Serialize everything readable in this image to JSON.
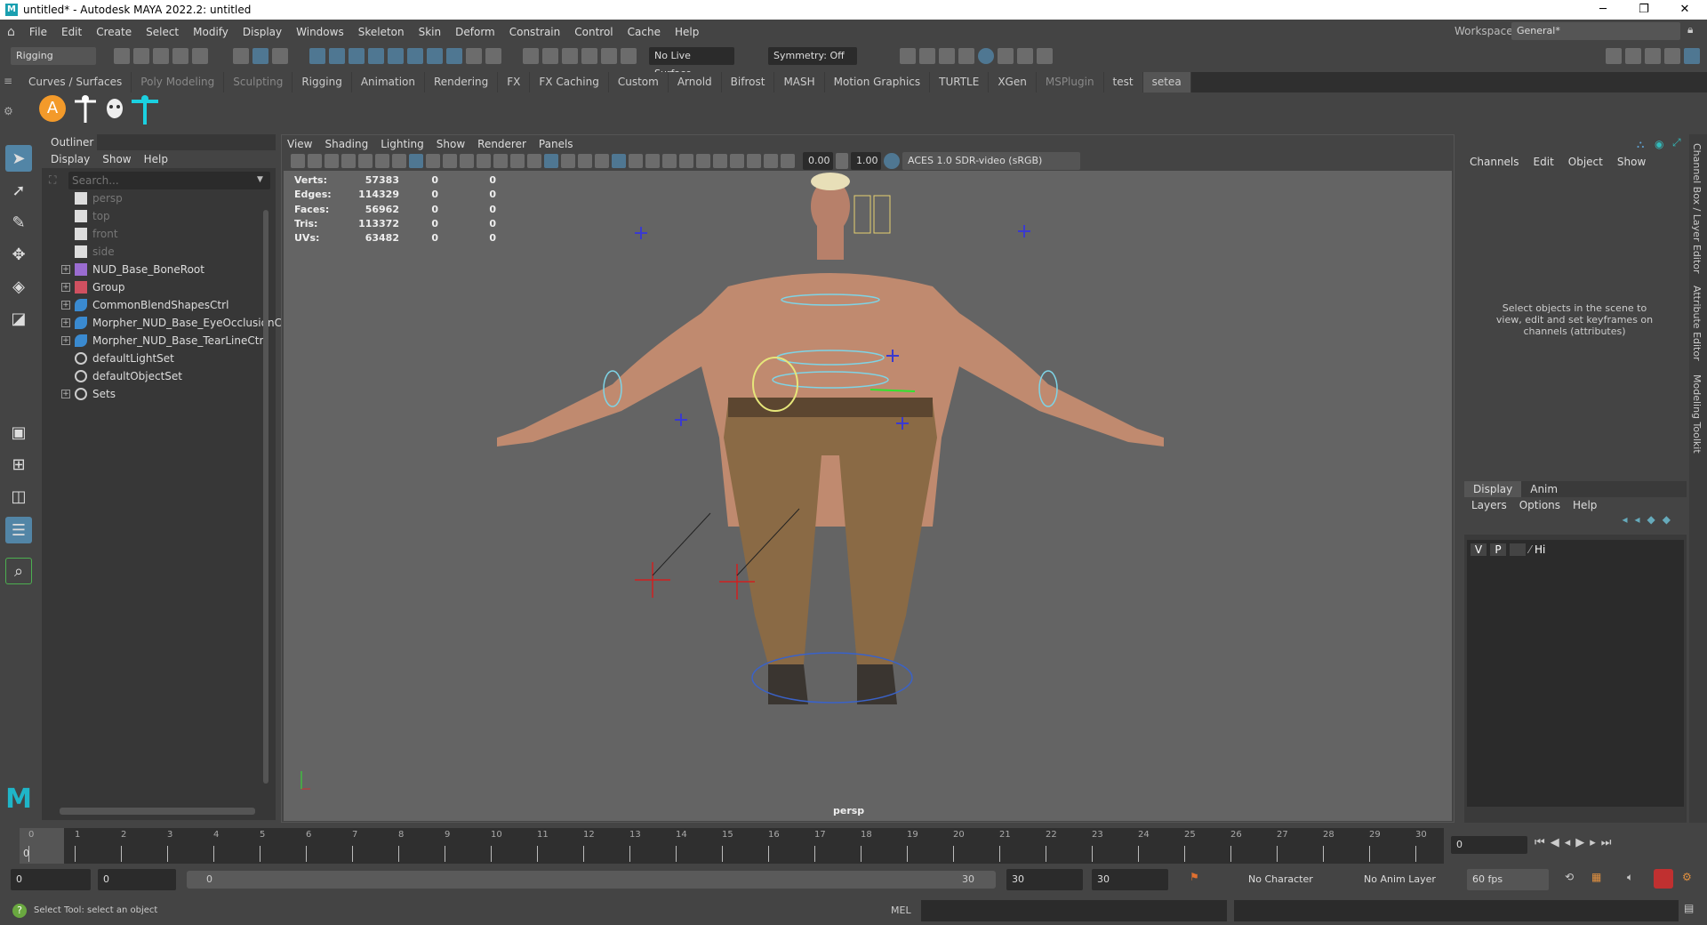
{
  "window": {
    "title": "untitled* - Autodesk MAYA 2022.2: untitled",
    "logo": "M",
    "controls": [
      "─",
      "❐",
      "✕"
    ]
  },
  "menubar": {
    "items": [
      "File",
      "Edit",
      "Create",
      "Select",
      "Modify",
      "Display",
      "Windows",
      "Skeleton",
      "Skin",
      "Deform",
      "Constrain",
      "Control",
      "Cache",
      "Help"
    ],
    "workspace_label": "Workspace:",
    "workspace_value": "General*"
  },
  "statusline": {
    "menuset": "Rigging",
    "live_surface": "No Live Surface",
    "symmetry": "Symmetry: Off"
  },
  "shelf": {
    "tabs": [
      "Curves / Surfaces",
      "Poly Modeling",
      "Sculpting",
      "Rigging",
      "Animation",
      "Rendering",
      "FX",
      "FX Caching",
      "Custom",
      "Arnold",
      "Bifrost",
      "MASH",
      "Motion Graphics",
      "TURTLE",
      "XGen",
      "MSPlugin",
      "test",
      "setea"
    ],
    "dim_tabs": [
      1,
      2,
      15
    ],
    "active_tab": "setea",
    "icons": [
      "arnold-icon",
      "skeleton-icon",
      "face-icon",
      "joint-icon"
    ],
    "arnold_label": "A"
  },
  "outliner": {
    "title": "Outliner",
    "menu": [
      "Display",
      "Show",
      "Help"
    ],
    "search_placeholder": "Search...",
    "items": [
      {
        "label": "persp",
        "icon": "camera",
        "dim": true,
        "expand": false
      },
      {
        "label": "top",
        "icon": "camera",
        "dim": true,
        "expand": false
      },
      {
        "label": "front",
        "icon": "camera",
        "dim": true,
        "expand": false
      },
      {
        "label": "side",
        "icon": "camera",
        "dim": true,
        "expand": false
      },
      {
        "label": "NUD_Base_BoneRoot",
        "icon": "joint",
        "expand": true
      },
      {
        "label": "Group",
        "icon": "group",
        "expand": true
      },
      {
        "label": "CommonBlendShapesCtrl",
        "icon": "curve",
        "expand": true
      },
      {
        "label": "Morpher_NUD_Base_EyeOcclusionCtr",
        "icon": "curve",
        "expand": true
      },
      {
        "label": "Morpher_NUD_Base_TearLineCtrl",
        "icon": "curve",
        "expand": true
      },
      {
        "label": "defaultLightSet",
        "icon": "set",
        "expand": false
      },
      {
        "label": "defaultObjectSet",
        "icon": "set",
        "expand": false
      },
      {
        "label": "Sets",
        "icon": "set",
        "expand": true
      }
    ]
  },
  "viewport": {
    "menu": [
      "View",
      "Shading",
      "Lighting",
      "Show",
      "Renderer",
      "Panels"
    ],
    "exposure": "0.00",
    "gamma": "1.00",
    "colorspace": "ACES 1.0 SDR-video (sRGB)",
    "camera_label": "persp",
    "hud": [
      {
        "label": "Verts:",
        "values": [
          "57383",
          "0",
          "0"
        ]
      },
      {
        "label": "Edges:",
        "values": [
          "114329",
          "0",
          "0"
        ]
      },
      {
        "label": "Faces:",
        "values": [
          "56962",
          "0",
          "0"
        ]
      },
      {
        "label": "Tris:",
        "values": [
          "113372",
          "0",
          "0"
        ]
      },
      {
        "label": "UVs:",
        "values": [
          "63482",
          "0",
          "0"
        ]
      }
    ]
  },
  "channelbox": {
    "menu": [
      "Channels",
      "Edit",
      "Object",
      "Show"
    ],
    "empty_message": "Select objects in the scene to view, edit and set keyframes on channels (attributes)",
    "layer_tabs": [
      "Display",
      "Anim"
    ],
    "layer_menu": [
      "Layers",
      "Options",
      "Help"
    ],
    "layer_row": {
      "v": "V",
      "p": "P",
      "name": "Hi"
    }
  },
  "sidetabs": [
    "Channel Box / Layer Editor",
    "Attribute Editor",
    "Modeling Toolkit"
  ],
  "timeline": {
    "ticks": [
      "0",
      "1",
      "2",
      "3",
      "4",
      "5",
      "6",
      "7",
      "8",
      "9",
      "10",
      "11",
      "12",
      "13",
      "14",
      "15",
      "16",
      "17",
      "18",
      "19",
      "20",
      "21",
      "22",
      "23",
      "24",
      "25",
      "26",
      "27",
      "28",
      "29",
      "30"
    ],
    "current_frame": "0",
    "current_field": "0"
  },
  "range": {
    "start": "0",
    "anim_start": "0",
    "range_start": "0",
    "range_end": "30",
    "end": "30",
    "anim_end": "30",
    "character_set": "No Character Set",
    "anim_layer": "No Anim Layer",
    "fps": "60 fps"
  },
  "commandline": {
    "help": "Select Tool: select an object",
    "lang": "MEL"
  }
}
